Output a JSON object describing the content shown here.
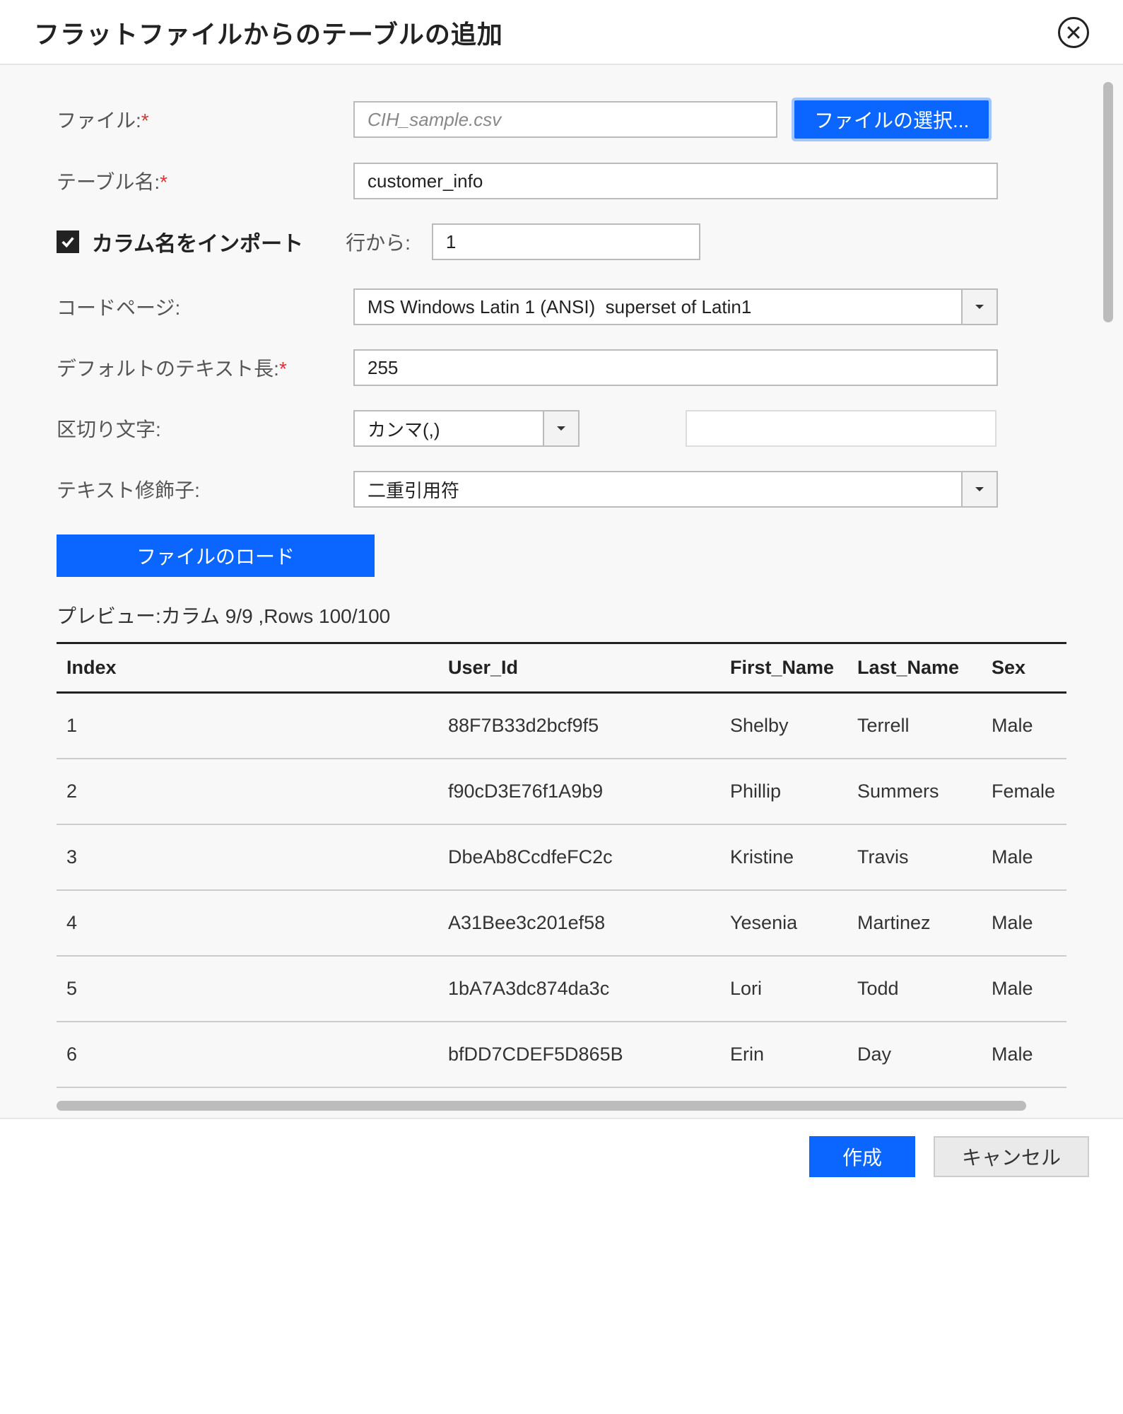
{
  "dialog": {
    "title": "フラットファイルからのテーブルの追加"
  },
  "form": {
    "file_label": "ファイル:",
    "file_value": "CIH_sample.csv",
    "choose_file_button": "ファイルの選択...",
    "table_name_label": "テーブル名:",
    "table_name_value": "customer_info",
    "import_column_names_label": "カラム名をインポート",
    "import_column_names_checked": true,
    "from_row_label": "行から:",
    "from_row_value": "1",
    "code_page_label": "コードページ:",
    "code_page_value": "MS Windows Latin 1 (ANSI)  superset of Latin1",
    "default_text_length_label": "デフォルトのテキスト長:",
    "default_text_length_value": "255",
    "delimiter_label": "区切り文字:",
    "delimiter_value": "カンマ(,)",
    "text_qualifier_label": "テキスト修飾子:",
    "text_qualifier_value": "二重引用符",
    "load_file_button": "ファイルのロード"
  },
  "preview": {
    "label": "プレビュー:カラム 9/9 ,Rows 100/100",
    "columns": [
      "Index",
      "User_Id",
      "First_Name",
      "Last_Name",
      "Sex"
    ],
    "rows": [
      {
        "index": "1",
        "user_id": "88F7B33d2bcf9f5",
        "first_name": "Shelby",
        "last_name": "Terrell",
        "sex": "Male"
      },
      {
        "index": "2",
        "user_id": "f90cD3E76f1A9b9",
        "first_name": "Phillip",
        "last_name": "Summers",
        "sex": "Female"
      },
      {
        "index": "3",
        "user_id": "DbeAb8CcdfeFC2c",
        "first_name": "Kristine",
        "last_name": "Travis",
        "sex": "Male"
      },
      {
        "index": "4",
        "user_id": "A31Bee3c201ef58",
        "first_name": "Yesenia",
        "last_name": "Martinez",
        "sex": "Male"
      },
      {
        "index": "5",
        "user_id": "1bA7A3dc874da3c",
        "first_name": "Lori",
        "last_name": "Todd",
        "sex": "Male"
      },
      {
        "index": "6",
        "user_id": "bfDD7CDEF5D865B",
        "first_name": "Erin",
        "last_name": "Day",
        "sex": "Male"
      }
    ]
  },
  "footer": {
    "create_button": "作成",
    "cancel_button": "キャンセル"
  }
}
